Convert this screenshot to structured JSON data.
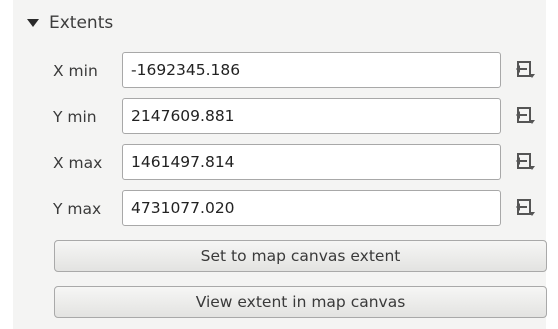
{
  "group": {
    "title": "Extents",
    "expanded": true
  },
  "fields": [
    {
      "label": "X min",
      "value": "-1692345.186"
    },
    {
      "label": "Y min",
      "value": "2147609.881"
    },
    {
      "label": "X max",
      "value": "1461497.814"
    },
    {
      "label": "Y max",
      "value": "4731077.020"
    }
  ],
  "buttons": {
    "set_extent": "Set to map canvas extent",
    "view_extent": "View extent in map canvas"
  },
  "icons": {
    "extent_menu": "extent-dropdown-icon",
    "collapse": "collapse-triangle-icon"
  }
}
